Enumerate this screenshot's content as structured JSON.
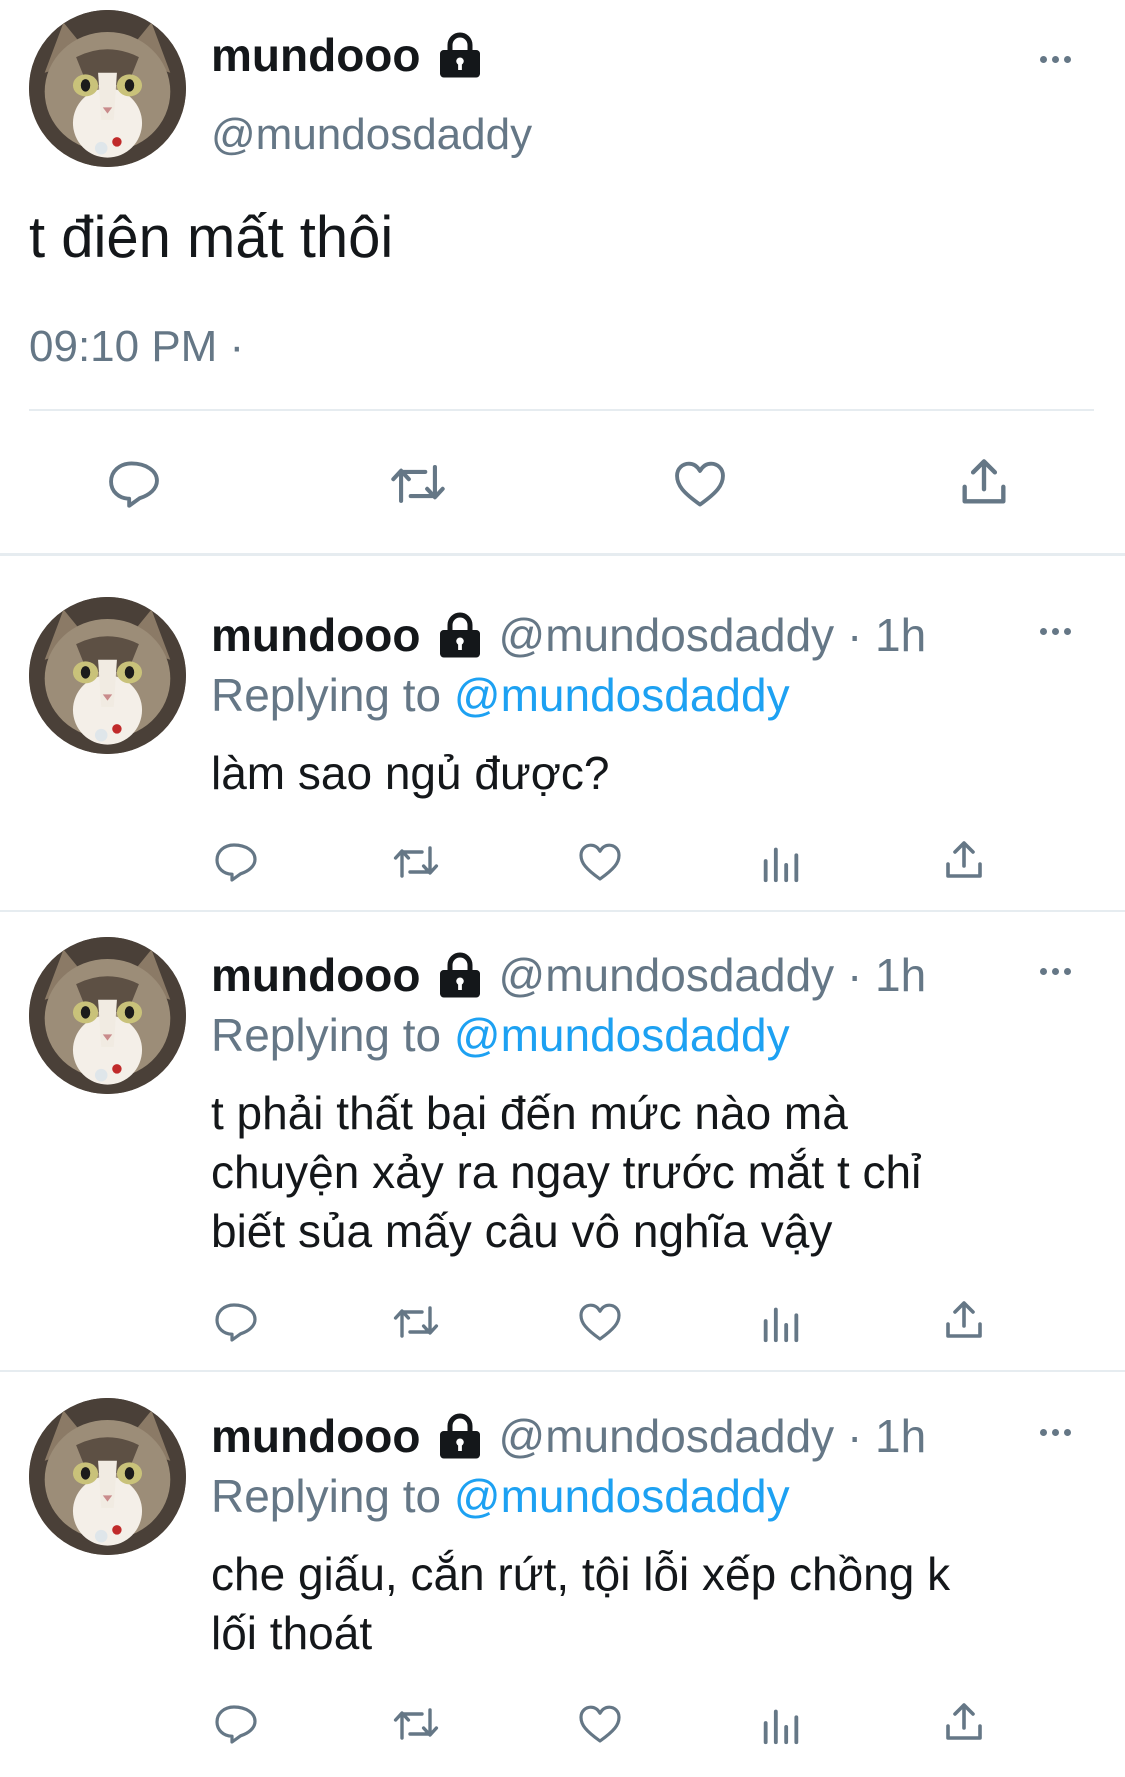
{
  "main_tweet": {
    "display_name": "mundooo",
    "handle": "@mundosdaddy",
    "text": "t điên mất thôi",
    "timestamp": "09:10 PM ·",
    "actions": [
      "reply-icon",
      "retweet-icon",
      "like-icon",
      "share-icon"
    ]
  },
  "replies": [
    {
      "display_name": "mundooo",
      "handle_time": "@mundosdaddy · 1h",
      "replying_prefix": "Replying to",
      "replying_handle": "@mundosdaddy",
      "text_lines": [
        "làm sao ngủ được?"
      ]
    },
    {
      "display_name": "mundooo",
      "handle_time": "@mundosdaddy · 1h",
      "replying_prefix": "Replying to",
      "replying_handle": "@mundosdaddy",
      "text_lines": [
        "t phải thất bại đến mức nào mà",
        "chuyện xảy ra ngay trước mắt t chỉ",
        "biết sủa mấy câu vô nghĩa vậy"
      ]
    },
    {
      "display_name": "mundooo",
      "handle_time": "@mundosdaddy · 1h",
      "replying_prefix": "Replying to",
      "replying_handle": "@mundosdaddy",
      "text_lines": [
        "che giấu, cắn rứt, tội lỗi xếp chồng k",
        "lối thoát"
      ]
    }
  ],
  "colors": {
    "text": "#14171a",
    "secondary": "#657786",
    "link": "#1da1f2",
    "divider": "#e6ecf0"
  }
}
